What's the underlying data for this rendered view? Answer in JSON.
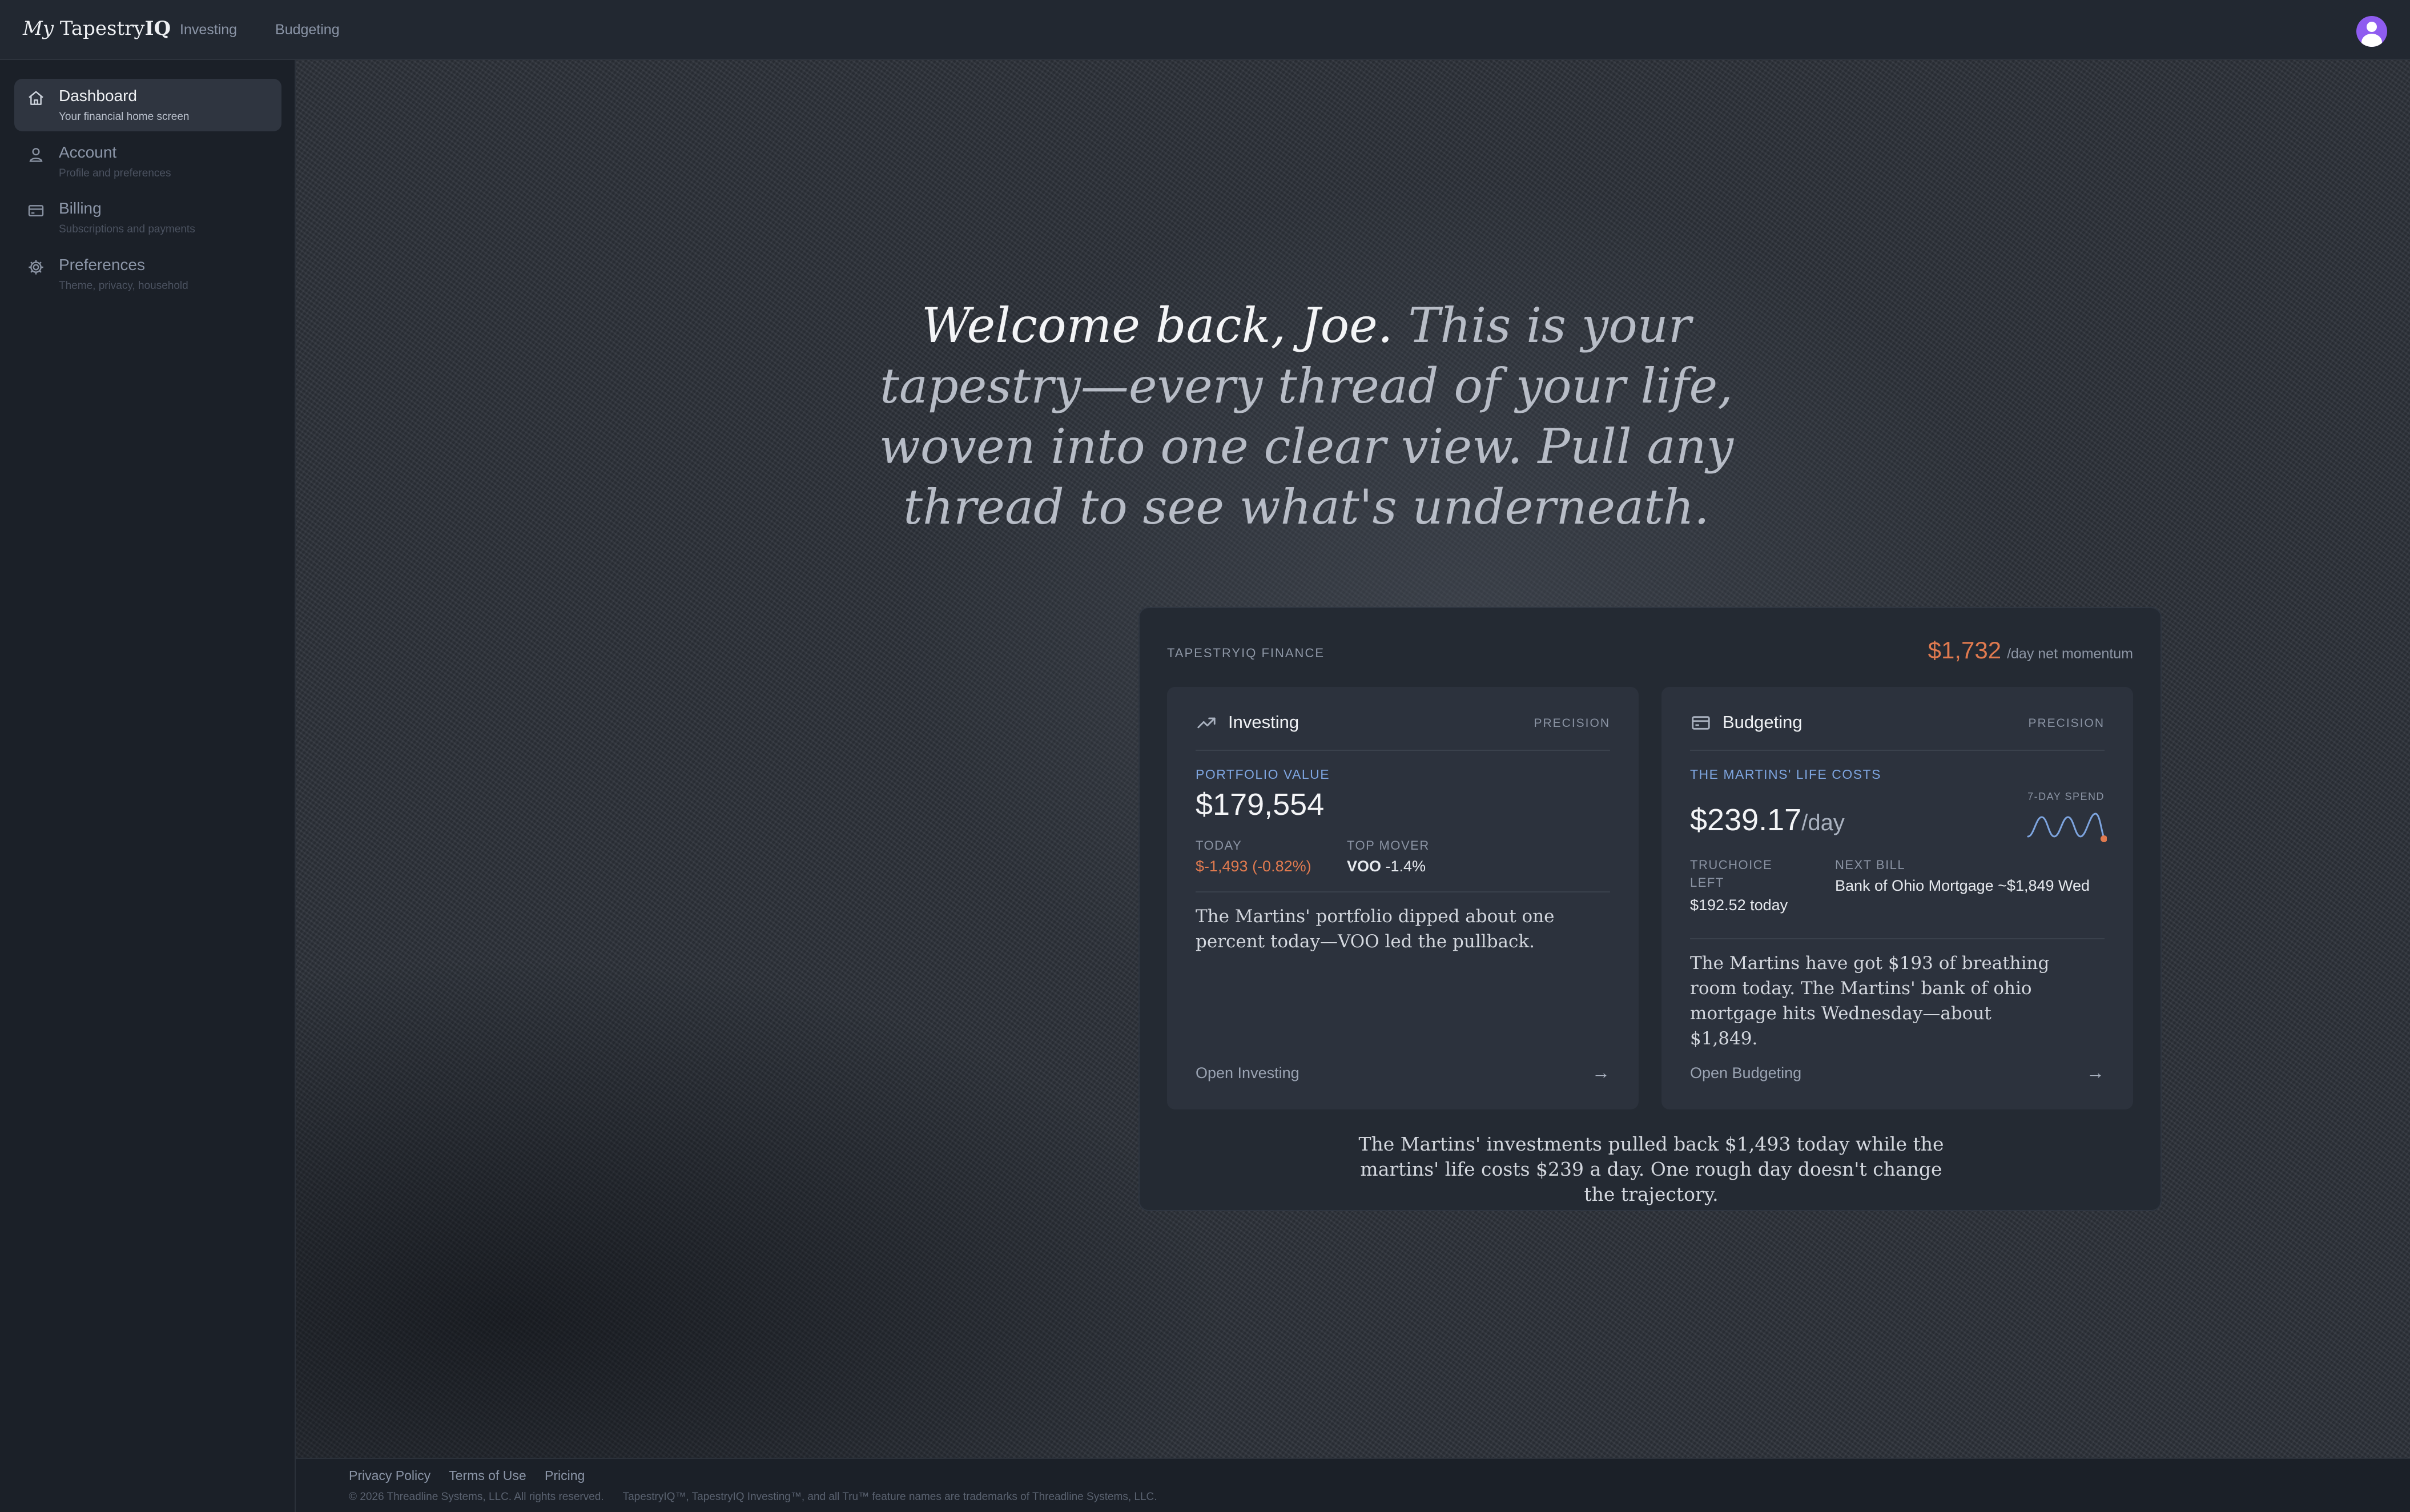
{
  "header": {
    "logo_prefix": "My",
    "logo_name": "Tapestry",
    "logo_suffix": "IQ",
    "nav": [
      "Investing",
      "Budgeting"
    ],
    "avatar_icon": "user-avatar-icon"
  },
  "sidebar": {
    "items": [
      {
        "label": "Dashboard",
        "sub": "Your financial home screen",
        "icon": "home-icon",
        "active": true
      },
      {
        "label": "Account",
        "sub": "Profile and preferences",
        "icon": "user-icon"
      },
      {
        "label": "Billing",
        "sub": "Subscriptions and payments",
        "icon": "credit-card-icon"
      },
      {
        "label": "Preferences",
        "sub": "Theme, privacy, household",
        "icon": "gear-icon"
      }
    ]
  },
  "hero": {
    "greeting": "Welcome back, Joe.",
    "message": "This is your tapestry—every thread of your life, woven into one clear view. Pull any thread to see what's underneath."
  },
  "panel": {
    "brand": "TAPESTRYIQ FINANCE",
    "momentum_value": "$1,732",
    "momentum_unit": "/day net momentum",
    "summary": "The Martins' investments pulled back $1,493 today while the martins' life costs $239 a day. One rough day doesn't change the trajectory."
  },
  "investing": {
    "title": "Investing",
    "tag": "PRECISION",
    "kicker": "PORTFOLIO VALUE",
    "value": "$179,554",
    "today_label": "TODAY",
    "today_value": "$-1,493 (-0.82%)",
    "mover_label": "TOP MOVER",
    "mover_ticker": "VOO",
    "mover_change": "-1.4%",
    "text": "The Martins' portfolio dipped about one percent today—VOO led the pullback.",
    "link": "Open Investing",
    "arrow": "→"
  },
  "budgeting": {
    "title": "Budgeting",
    "tag": "PRECISION",
    "kicker": "THE MARTINS' LIFE COSTS",
    "value": "$239.17",
    "value_unit": "/day",
    "spark_label": "7-DAY SPEND",
    "left_label": "TRUCHOICE LEFT",
    "left_value": "$192.52 today",
    "bill_label": "NEXT BILL",
    "bill_value": "Bank of Ohio Mortgage ~$1,849 Wed",
    "text": "The Martins have got $193 of breathing room today. The Martins' bank of ohio mortgage hits Wednesday—about $1,849.",
    "link": "Open Budgeting",
    "arrow": "→"
  },
  "footer": {
    "links": [
      "Privacy Policy",
      "Terms of Use",
      "Pricing"
    ],
    "copyright": "© 2026 Threadline Systems, LLC. All rights reserved.",
    "trademark": "TapestryIQ™, TapestryIQ Investing™, and all Tru™ feature names are trademarks of Threadline Systems, LLC."
  },
  "colors": {
    "accent_orange": "#e07a4f",
    "accent_blue": "#7ea5e0",
    "avatar": "#8f5cf0"
  }
}
